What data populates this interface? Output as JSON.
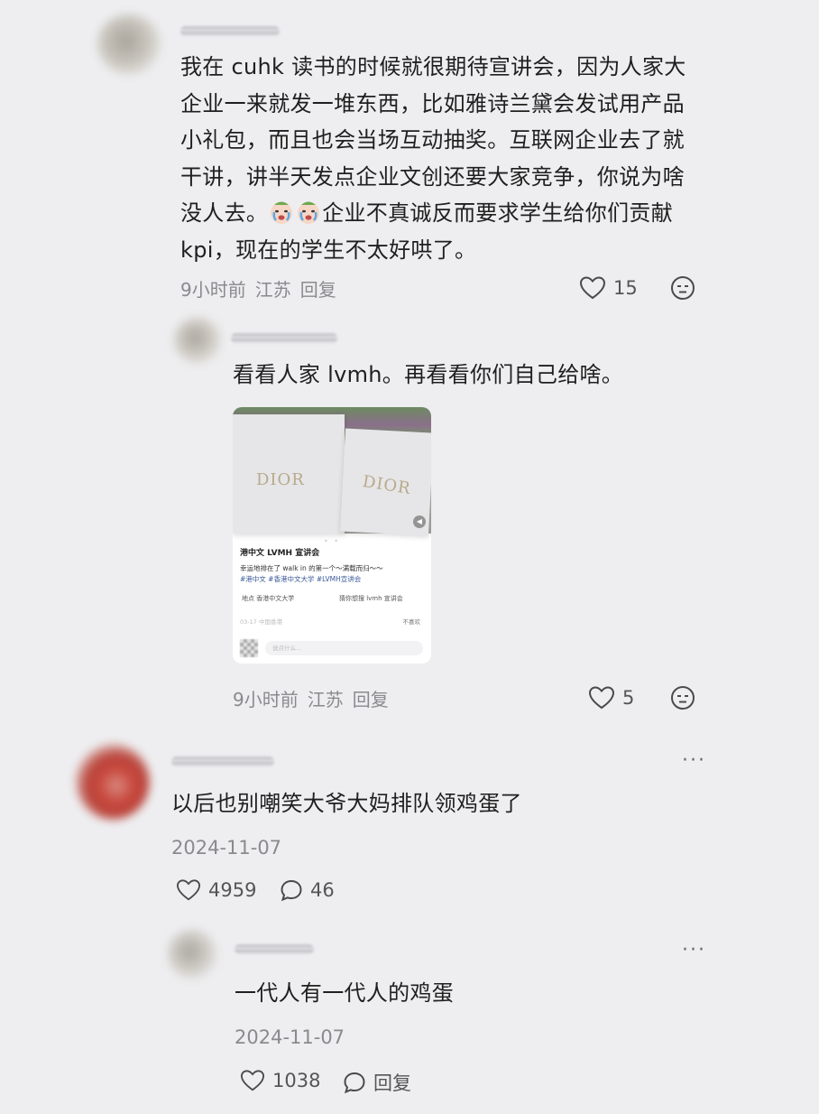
{
  "comments": [
    {
      "text": "我在 cuhk 读书的时候就很期待宣讲会，因为人家大企业一来就发一堆东西，比如雅诗兰黛会发试用产品小礼包，而且也会当场互动抽奖。互联网企业去了就干讲，讲半天发点企业文创还要大家竞争，你说为啥没人去。",
      "text_after_emoji": "企业不真诚反而要求学生给你们贡献 kpi，现在的学生不太好哄了。",
      "time": "9小时前",
      "location": "江苏",
      "reply_label": "回复",
      "likes": "15",
      "reply": {
        "text": "看看人家 lvmh。再看看你们自己给啥。",
        "time": "9小时前",
        "location": "江苏",
        "reply_label": "回复",
        "likes": "5",
        "image": {
          "brand": "DIOR",
          "post_title": "港中文 LVMH 宣讲会",
          "post_desc": "幸运地排在了 walk in 的第一个～满载而归～～",
          "post_tags": "#港中文 #香港中文大学 #LVMH宣讲会",
          "location_label": "地点  香港中文大学",
          "keyword_label": "猜你想搜  lvmh 宣讲会",
          "post_time": "03-17 中国香港",
          "dislike": "不喜欢",
          "input_placeholder": "说点什么..."
        }
      }
    },
    {
      "text": "以后也别嘲笑大爷大妈排队领鸡蛋了",
      "date": "2024-11-07",
      "likes": "4959",
      "comments": "46",
      "reply": {
        "text": "一代人有一代人的鸡蛋",
        "date": "2024-11-07",
        "likes": "1038",
        "reply_label": "回复"
      }
    }
  ],
  "more_label": "···",
  "colors": {
    "background": "#eeeef0",
    "text": "#1f1f1f",
    "meta": "#8a8a8e"
  },
  "icons": [
    "heart-icon",
    "emoji-face-icon",
    "comment-bubble-icon",
    "more-icon",
    "crying-emoji-icon"
  ]
}
